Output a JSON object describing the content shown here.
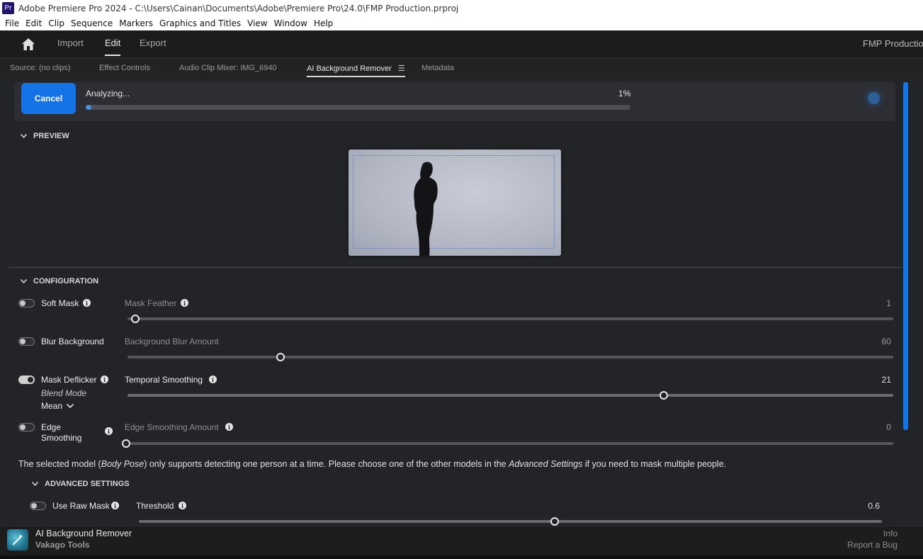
{
  "window": {
    "app_icon": "Pr",
    "title": "Adobe Premiere Pro 2024 - C:\\Users\\Cainan\\Documents\\Adobe\\Premiere Pro\\24.0\\FMP Production.prproj"
  },
  "menu": [
    "File",
    "Edit",
    "Clip",
    "Sequence",
    "Markers",
    "Graphics and Titles",
    "View",
    "Window",
    "Help"
  ],
  "topnav": {
    "tabs": [
      "Import",
      "Edit",
      "Export"
    ],
    "active": "Edit",
    "project_name": "FMP Production"
  },
  "panel_tabs": [
    "Source: (no clips)",
    "Effect Controls",
    "Audio Clip Mixer: IMG_6940",
    "AI Background Remover",
    "Metadata"
  ],
  "analyze": {
    "cancel_label": "Cancel",
    "status": "Analyzing...",
    "progress_text": "1%",
    "progress": 0.01
  },
  "preview": {
    "heading": "PREVIEW"
  },
  "configuration": {
    "heading": "CONFIGURATION",
    "soft_mask": {
      "label": "Soft Mask",
      "enabled": false,
      "slider_label": "Mask Feather",
      "value": "1",
      "fraction": 0.01
    },
    "blur_background": {
      "label": "Blur Background",
      "enabled": false,
      "slider_label": "Background Blur Amount",
      "value": "60",
      "fraction": 0.2
    },
    "mask_deflicker": {
      "label": "Mask Deflicker",
      "enabled": true,
      "blend_mode_label": "Blend Mode",
      "blend_mode_value": "Mean",
      "slider_label": "Temporal Smoothing",
      "value": "21",
      "fraction": 0.7
    },
    "edge_smoothing": {
      "label_line1": "Edge",
      "label_line2": "Smoothing",
      "enabled": false,
      "slider_label": "Edge Smoothing Amount",
      "value": "0",
      "fraction": 0.0
    }
  },
  "note": {
    "part1": "The selected model (",
    "model": "Body Pose",
    "part2": ") only supports detecting one person at a time. Please choose one of the other models in the ",
    "link": "Advanced Settings",
    "part3": " if you need to mask multiple people."
  },
  "advanced": {
    "heading": "ADVANCED SETTINGS",
    "use_raw_mask": {
      "label": "Use Raw Mask",
      "enabled": false,
      "slider_label": "Threshold",
      "value": "0.6",
      "fraction": 0.56
    }
  },
  "footer": {
    "title": "AI Background Remover",
    "subtitle": "Vakago Tools",
    "info_link": "Info",
    "bug_link": "Report a Bug"
  },
  "colors": {
    "accent": "#1473e6",
    "panel_bg": "#232428"
  }
}
